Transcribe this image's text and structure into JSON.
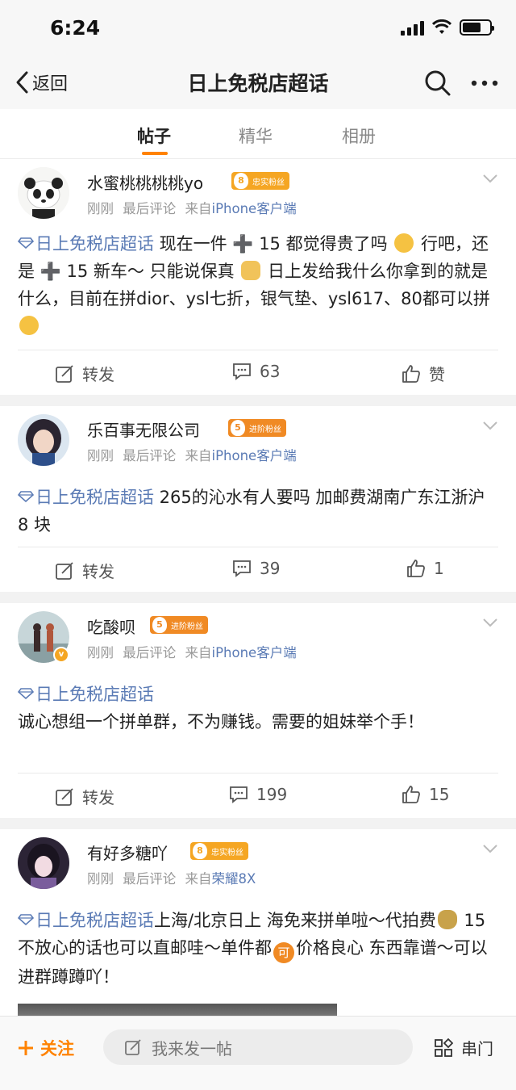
{
  "status": {
    "time": "6:24"
  },
  "nav": {
    "back_label": "返回",
    "title": "日上免税店超话"
  },
  "tabs": [
    {
      "label": "帖子",
      "active": true
    },
    {
      "label": "精华",
      "active": false
    },
    {
      "label": "相册",
      "active": false
    }
  ],
  "colors": {
    "accent": "#ff8200",
    "link": "#5b7bb5",
    "badge_gold": "#f5a623",
    "badge_orange": "#f08a24"
  },
  "posts": [
    {
      "username": "水蜜桃桃桃桃yo",
      "badge": {
        "level": "8",
        "label": "忠实粉丝"
      },
      "time": "刚刚",
      "last_comment": "最后评论",
      "source_prefix": "来自",
      "source": "iPhone客户端",
      "topic": "日上免税店超话",
      "text_parts": [
        " 现在一件 ",
        "➕",
        " 15 都觉得贵了吗 ",
        " 行吧，还是 ",
        "➕",
        " 15 新车～ 只能说保真 ",
        " 日上发给我什么你拿到的就是什么，目前在拼dior、ysl七折，银气垫、ysl617、80都可以拼 "
      ],
      "repost_label": "转发",
      "comments": "63",
      "likes": "赞"
    },
    {
      "username": "乐百事无限公司",
      "badge": {
        "level": "5",
        "label": "进阶粉丝"
      },
      "time": "刚刚",
      "last_comment": "最后评论",
      "source_prefix": "来自",
      "source": "iPhone客户端",
      "topic": "日上免税店超话",
      "text": " 265的沁水有人要吗 加邮费湖南广东江浙沪 8 块",
      "repost_label": "转发",
      "comments": "39",
      "likes": "1"
    },
    {
      "username": "吃酸呗",
      "badge": {
        "level": "5",
        "label": "进阶粉丝"
      },
      "time": "刚刚",
      "last_comment": "最后评论",
      "source_prefix": "来自",
      "source": "iPhone客户端",
      "topic": "日上免税店超话",
      "text": "诚心想组一个拼单群，不为赚钱。需要的姐妹举个手！",
      "repost_label": "转发",
      "comments": "199",
      "likes": "15"
    },
    {
      "username": "有好多糖吖",
      "badge": {
        "level": "8",
        "label": "忠实粉丝"
      },
      "time": "刚刚",
      "last_comment": "最后评论",
      "source_prefix": "来自",
      "source": "荣耀8X",
      "topic": "日上免税店超话",
      "text_a": "上海/北京日上 海免来拼单啦～代拍费",
      "text_b": " 15  不放心的话也可以直邮哇～单件都",
      "text_c": "价格良心 东西靠谱～可以进群蹲蹲吖！",
      "inline_badge": "可"
    }
  ],
  "bottom": {
    "follow_label": "关注",
    "compose_placeholder": "我来发一帖",
    "chuanmen_label": "串门"
  }
}
